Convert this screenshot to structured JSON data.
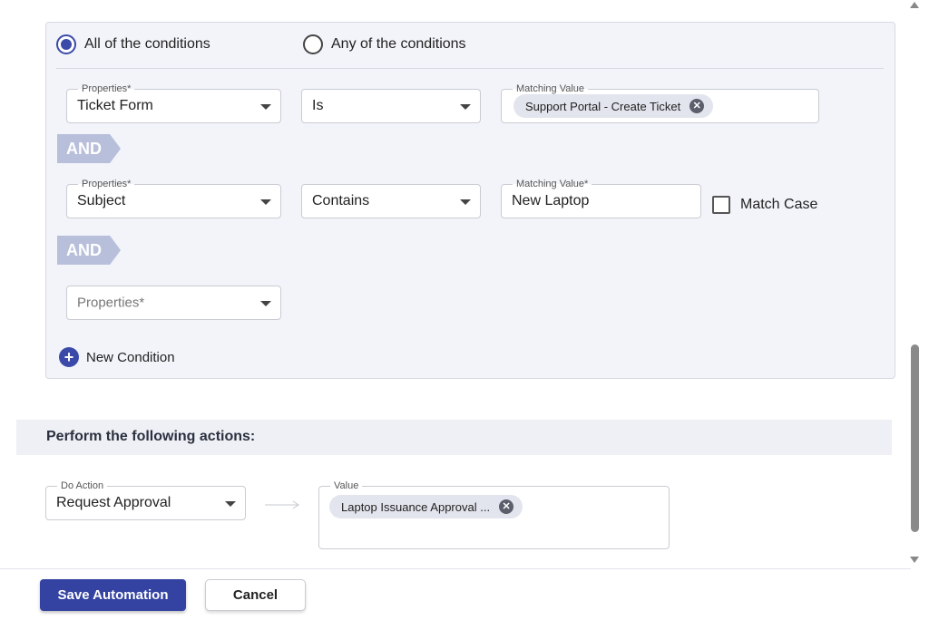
{
  "match_mode": {
    "all_label": "All of the conditions",
    "any_label": "Any of the conditions",
    "selected": "all"
  },
  "conditions": [
    {
      "property_label": "Properties*",
      "property_value": "Ticket Form",
      "operator": "Is",
      "value_label": "Matching Value",
      "value_chip": "Support Portal - Create Ticket"
    },
    {
      "connector": "AND",
      "property_label": "Properties*",
      "property_value": "Subject",
      "operator": "Contains",
      "value_label": "Matching Value*",
      "value_text": "New Laptop",
      "match_case_label": "Match Case",
      "match_case_checked": false
    },
    {
      "connector": "AND",
      "property_placeholder": "Properties*"
    }
  ],
  "new_condition_label": "New Condition",
  "actions": {
    "section_title": "Perform the following actions:",
    "do_action_label": "Do Action",
    "do_action_value": "Request Approval",
    "value_label": "Value",
    "value_chip": "Laptop Issuance Approval ..."
  },
  "footer": {
    "save_label": "Save Automation",
    "cancel_label": "Cancel"
  },
  "colors": {
    "primary": "#3442a1",
    "and_tag": "#b8bfdb",
    "panel_bg": "#f2f4f9"
  }
}
